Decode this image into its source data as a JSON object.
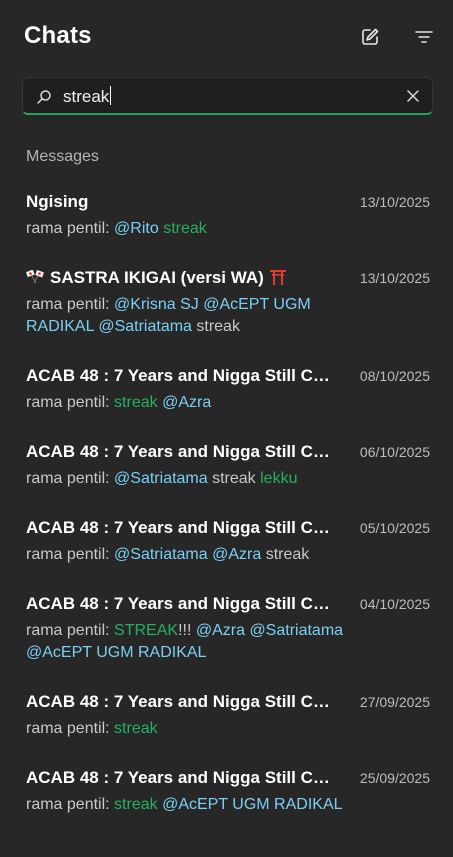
{
  "header": {
    "title": "Chats",
    "compose_icon": "compose-icon",
    "filter_icon": "filter-icon"
  },
  "search": {
    "value": "streak",
    "search_icon": "search-icon",
    "clear_icon": "close-icon"
  },
  "section_label": "Messages",
  "colors": {
    "accent": "#25a35a",
    "mention": "#7ad0f2",
    "highlight": "#25b062",
    "background": "#272727"
  },
  "results": [
    {
      "name": "Ngising",
      "date": "13/10/2025",
      "preview": [
        {
          "t": "rama pentil: ",
          "k": "n"
        },
        {
          "t": "@Rito",
          "k": "m"
        },
        {
          "t": " ",
          "k": "n"
        },
        {
          "t": "streak",
          "k": "h"
        }
      ]
    },
    {
      "name": "SASTRA IKIGAI (versi WA)",
      "date": "13/10/2025",
      "emoji_left": "japan-crossed-flags",
      "emoji_right": "torii-gate",
      "preview": [
        {
          "t": "rama pentil: ",
          "k": "n"
        },
        {
          "t": "@Krisna SJ",
          "k": "m"
        },
        {
          "t": " ",
          "k": "n"
        },
        {
          "t": "@AcEPT UGM RADIKAL",
          "k": "m"
        },
        {
          "t": " ",
          "k": "n"
        },
        {
          "t": "@Satriatama",
          "k": "m"
        },
        {
          "t": " streak",
          "k": "n"
        }
      ]
    },
    {
      "name": "ACAB 48 : 7 Years and Nigga Still Co...",
      "date": "08/10/2025",
      "preview": [
        {
          "t": "rama pentil: ",
          "k": "n"
        },
        {
          "t": "streak",
          "k": "h"
        },
        {
          "t": " ",
          "k": "n"
        },
        {
          "t": "@Azra",
          "k": "m"
        }
      ]
    },
    {
      "name": "ACAB 48 : 7 Years and Nigga Still Co...",
      "date": "06/10/2025",
      "preview": [
        {
          "t": "rama pentil: ",
          "k": "n"
        },
        {
          "t": "@Satriatama",
          "k": "m"
        },
        {
          "t": " streak ",
          "k": "n"
        },
        {
          "t": "lekku",
          "k": "h"
        }
      ]
    },
    {
      "name": "ACAB 48 : 7 Years and Nigga Still Co...",
      "date": "05/10/2025",
      "preview": [
        {
          "t": "rama pentil: ",
          "k": "n"
        },
        {
          "t": "@Satriatama",
          "k": "m"
        },
        {
          "t": " ",
          "k": "n"
        },
        {
          "t": "@Azra",
          "k": "m"
        },
        {
          "t": " streak",
          "k": "n"
        }
      ]
    },
    {
      "name": "ACAB 48 : 7 Years and Nigga Still Co...",
      "date": "04/10/2025",
      "preview": [
        {
          "t": "rama pentil: ",
          "k": "n"
        },
        {
          "t": "STREAK",
          "k": "h"
        },
        {
          "t": "!!! ",
          "k": "n"
        },
        {
          "t": "@Azra",
          "k": "m"
        },
        {
          "t": " ",
          "k": "n"
        },
        {
          "t": "@Satriatama",
          "k": "m"
        },
        {
          "t": " ",
          "k": "n"
        },
        {
          "t": "@AcEPT UGM RADIKAL",
          "k": "m"
        }
      ]
    },
    {
      "name": "ACAB 48 : 7 Years and Nigga Still Co...",
      "date": "27/09/2025",
      "preview": [
        {
          "t": "rama pentil: ",
          "k": "n"
        },
        {
          "t": "streak",
          "k": "h"
        }
      ]
    },
    {
      "name": "ACAB 48 : 7 Years and Nigga Still Co...",
      "date": "25/09/2025",
      "preview": [
        {
          "t": "rama pentil: ",
          "k": "n"
        },
        {
          "t": "streak",
          "k": "h"
        },
        {
          "t": " ",
          "k": "n"
        },
        {
          "t": "@AcEPT UGM RADIKAL",
          "k": "m"
        }
      ]
    }
  ]
}
